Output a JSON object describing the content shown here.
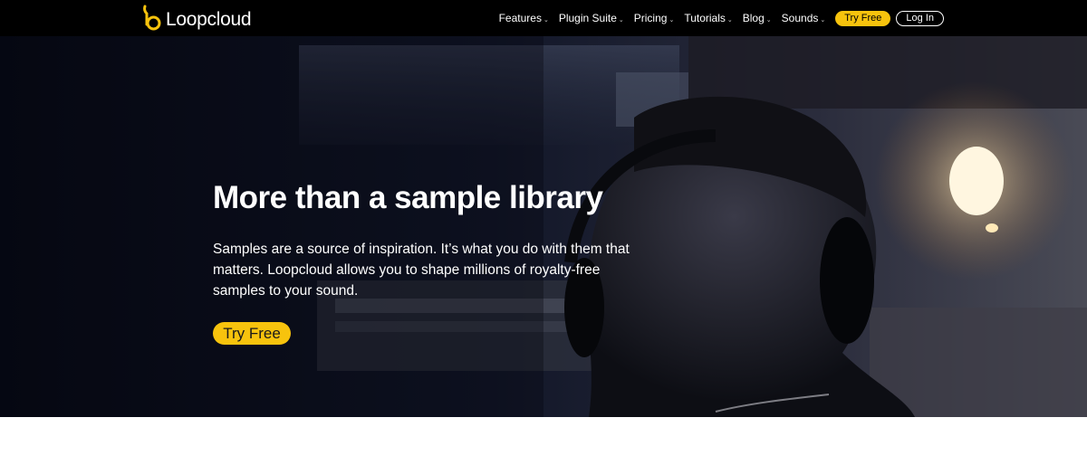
{
  "brand": {
    "name": "Loopcloud",
    "accent_color": "#f7c30d"
  },
  "nav": {
    "items": [
      {
        "label": "Features",
        "icon": "chevron-down-icon"
      },
      {
        "label": "Plugin Suite",
        "icon": "chevron-down-icon"
      },
      {
        "label": "Pricing",
        "icon": "chevron-down-icon"
      },
      {
        "label": "Tutorials",
        "icon": "chevron-down-icon"
      },
      {
        "label": "Blog",
        "icon": "chevron-down-icon"
      },
      {
        "label": "Sounds",
        "icon": "chevron-down-icon"
      }
    ],
    "try_free_label": "Try Free",
    "login_label": "Log In"
  },
  "hero": {
    "title": "More than a sample library",
    "body": "Samples are a source of inspiration. It’s what you do with them that matters. Loopcloud allows you to shape millions of royalty-free samples to your sound.",
    "cta_label": "Try Free"
  }
}
